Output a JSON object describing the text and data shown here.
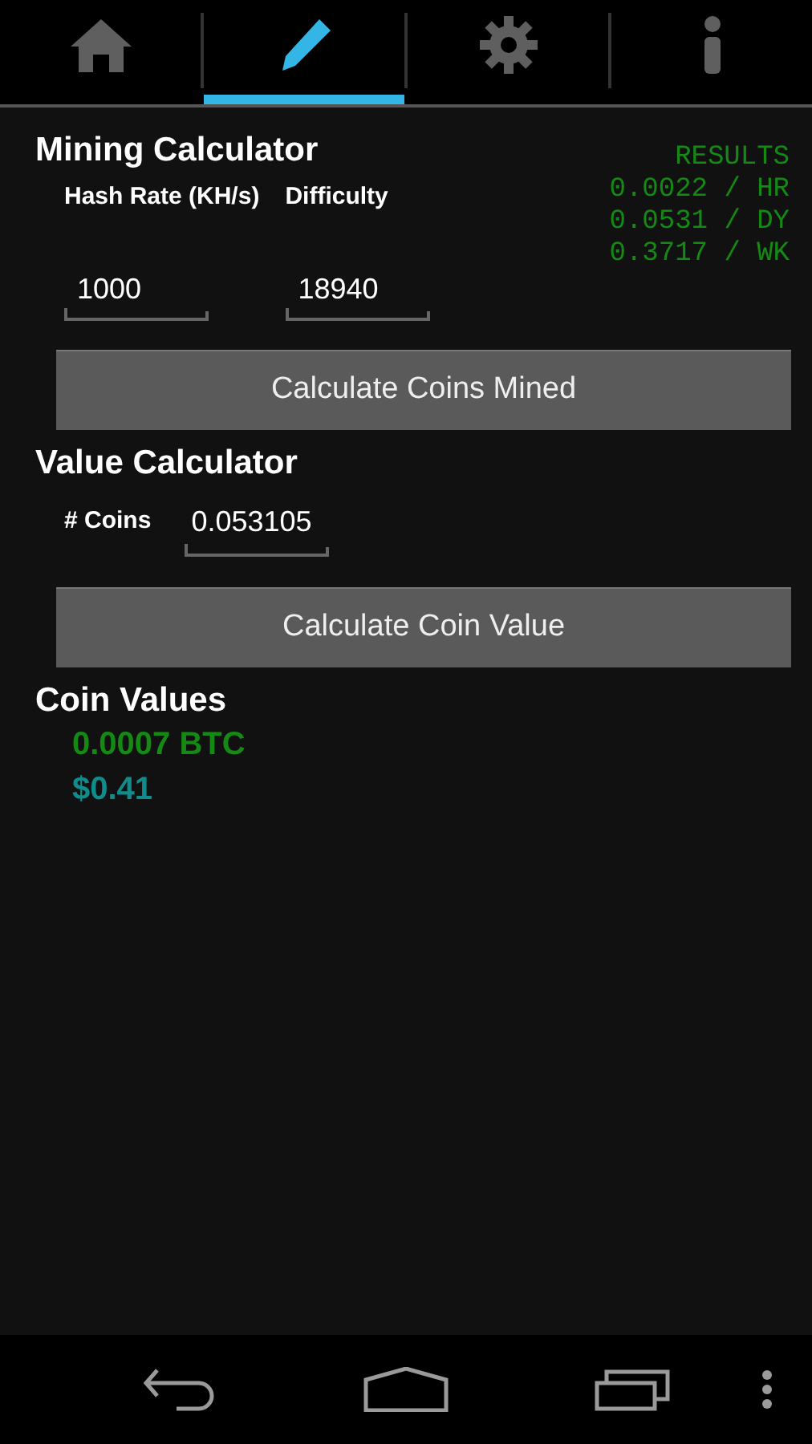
{
  "tabs": [
    {
      "kind": "home",
      "selected": false
    },
    {
      "kind": "edit",
      "selected": true
    },
    {
      "kind": "settings",
      "selected": false
    },
    {
      "kind": "info",
      "selected": false
    }
  ],
  "mining_calculator": {
    "title": "Mining Calculator",
    "fields": [
      {
        "label": "Hash Rate (KH/s)",
        "value": "1000"
      },
      {
        "label": "Difficulty",
        "value": "18940"
      }
    ],
    "results": {
      "heading": "RESULTS",
      "lines": [
        "0.0022 / HR",
        "0.0531 / DY",
        "0.3717 / WK"
      ]
    },
    "button": "Calculate Coins Mined"
  },
  "value_calculator": {
    "title": "Value Calculator",
    "field": {
      "label": "# Coins",
      "value": "0.053105"
    },
    "button": "Calculate Coin Value"
  },
  "coin_values": {
    "title": "Coin Values",
    "items": [
      {
        "text": "0.0007 BTC",
        "color": "#148a14"
      },
      {
        "text": "$0.41",
        "color": "#108c8c"
      }
    ]
  },
  "nav_bar": [
    {
      "kind": "back"
    },
    {
      "kind": "home"
    },
    {
      "kind": "recents"
    },
    {
      "kind": "menu"
    }
  ]
}
